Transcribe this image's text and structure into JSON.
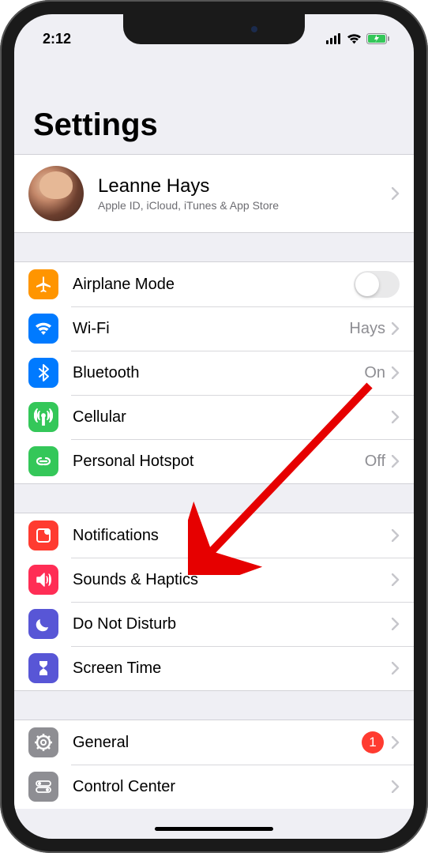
{
  "status": {
    "time": "2:12"
  },
  "title": "Settings",
  "profile": {
    "name": "Leanne Hays",
    "subtitle": "Apple ID, iCloud, iTunes & App Store"
  },
  "groups": [
    {
      "id": "connectivity",
      "rows": [
        {
          "id": "airplane",
          "label": "Airplane Mode",
          "icon": "airplane",
          "color": "bg-orange",
          "control": "toggle",
          "value": ""
        },
        {
          "id": "wifi",
          "label": "Wi-Fi",
          "icon": "wifi",
          "color": "bg-blue",
          "control": "disclosure",
          "value": "Hays"
        },
        {
          "id": "bluetooth",
          "label": "Bluetooth",
          "icon": "bluetooth",
          "color": "bg-blue",
          "control": "disclosure",
          "value": "On"
        },
        {
          "id": "cellular",
          "label": "Cellular",
          "icon": "antenna",
          "color": "bg-green",
          "control": "disclosure",
          "value": ""
        },
        {
          "id": "hotspot",
          "label": "Personal Hotspot",
          "icon": "link",
          "color": "bg-green",
          "control": "disclosure",
          "value": "Off"
        }
      ]
    },
    {
      "id": "notifications",
      "rows": [
        {
          "id": "notifications",
          "label": "Notifications",
          "icon": "notification",
          "color": "bg-red",
          "control": "disclosure",
          "value": ""
        },
        {
          "id": "sounds",
          "label": "Sounds & Haptics",
          "icon": "speaker",
          "color": "bg-pink",
          "control": "disclosure",
          "value": ""
        },
        {
          "id": "dnd",
          "label": "Do Not Disturb",
          "icon": "moon",
          "color": "bg-purple",
          "control": "disclosure",
          "value": ""
        },
        {
          "id": "screentime",
          "label": "Screen Time",
          "icon": "hourglass",
          "color": "bg-purple",
          "control": "disclosure",
          "value": ""
        }
      ]
    },
    {
      "id": "general",
      "rows": [
        {
          "id": "general",
          "label": "General",
          "icon": "gear",
          "color": "bg-gray",
          "control": "disclosure",
          "value": "",
          "badge": "1"
        },
        {
          "id": "controlcenter",
          "label": "Control Center",
          "icon": "switches",
          "color": "bg-gray",
          "control": "disclosure",
          "value": ""
        }
      ]
    }
  ]
}
